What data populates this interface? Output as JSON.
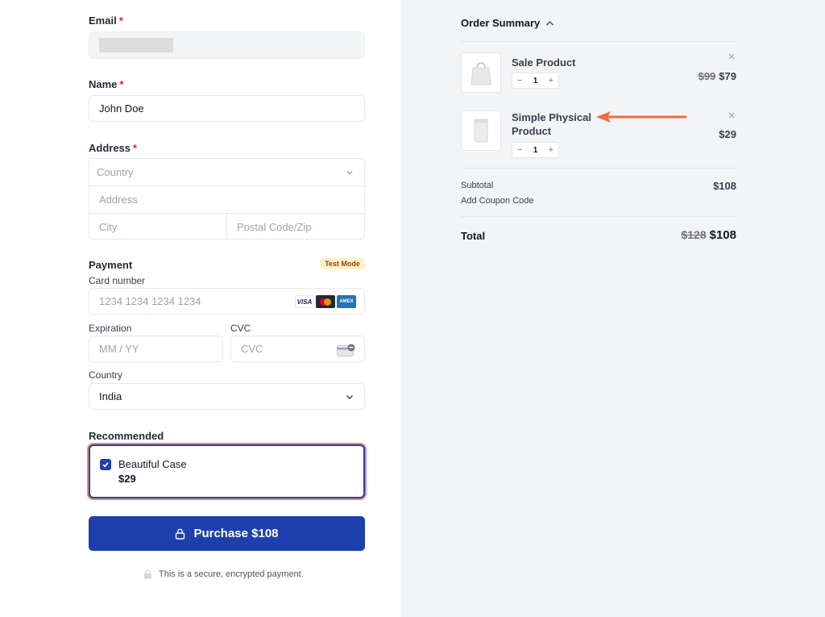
{
  "form": {
    "email": {
      "label": "Email",
      "required": "*"
    },
    "name": {
      "label": "Name",
      "required": "*",
      "value": "John Doe"
    },
    "address": {
      "label": "Address",
      "required": "*",
      "country_placeholder": "Country",
      "address_placeholder": "Address",
      "city_placeholder": "City",
      "zip_placeholder": "Postal Code/Zip"
    },
    "payment": {
      "label": "Payment",
      "badge": "Test Mode",
      "card_label": "Card number",
      "card_placeholder": "1234 1234 1234 1234",
      "card_brands": [
        "VISA",
        "mastercard",
        "AMEX"
      ],
      "expiration_label": "Expiration",
      "expiration_placeholder": "MM / YY",
      "cvc_label": "CVC",
      "cvc_placeholder": "CVC",
      "country_label": "Country",
      "country_value": "India"
    },
    "recommended": {
      "label": "Recommended",
      "item_name": "Beautiful Case",
      "item_price": "$29",
      "checked": true
    },
    "purchase_label": "Purchase $108",
    "secure_note": "This is a secure, encrypted payment."
  },
  "summary": {
    "title": "Order Summary",
    "items": [
      {
        "name": "Sale Product",
        "qty": "1",
        "old_price": "$99",
        "price": "$79"
      },
      {
        "name": "Simple Physical Product",
        "qty": "1",
        "old_price": "",
        "price": "$29"
      }
    ],
    "subtotal_label": "Subtotal",
    "subtotal_value": "$108",
    "coupon_label": "Add Coupon Code",
    "total_label": "Total",
    "total_old": "$128",
    "total_value": "$108"
  },
  "colors": {
    "accent": "#1e40af",
    "annotation_arrow": "#f26b3a",
    "required": "#dc2626",
    "badge_bg": "#fef3c7"
  }
}
